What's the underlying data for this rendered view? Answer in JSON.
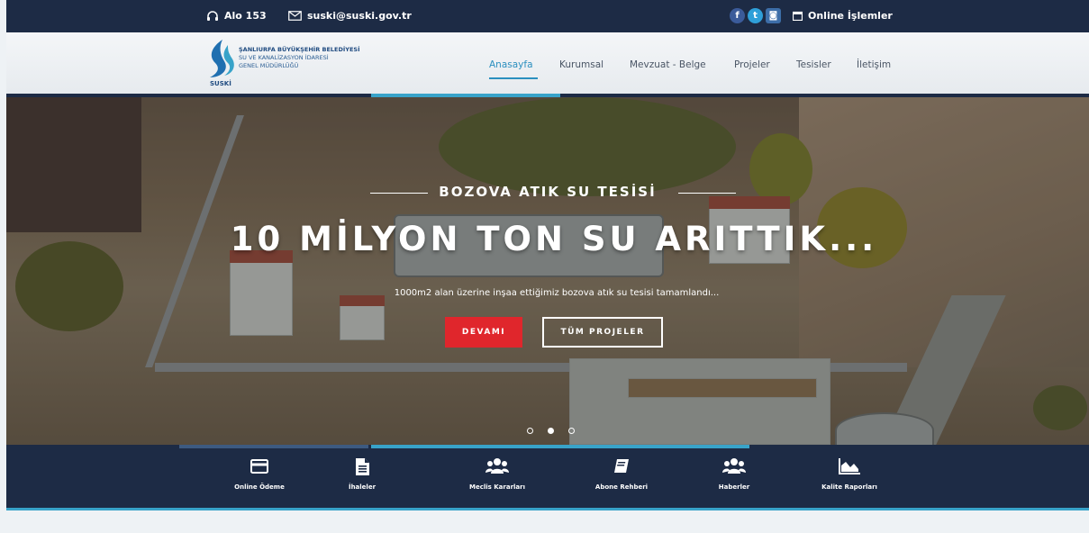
{
  "topbar": {
    "phone_label": "Alo 153",
    "email_label": "suski@suski.gov.tr",
    "social": [
      {
        "icon": "facebook-icon",
        "glyph": "f",
        "color": "#3b5b9a"
      },
      {
        "icon": "twitter-icon",
        "glyph": "t",
        "color": "#2f9fd8"
      },
      {
        "icon": "instagram-icon",
        "glyph": "◙",
        "color": "#3d6ea8"
      }
    ],
    "online_label": "Online İşlemler"
  },
  "logo": {
    "line1": "ŞANLIURFA BÜYÜKŞEHİR BELEDİYESİ",
    "line2": "SU VE KANALİZASYON İDARESİ",
    "line3": "GENEL MÜDÜRLÜĞÜ",
    "brand": "SUSKİ"
  },
  "nav": {
    "items": [
      {
        "label": "Anasayfa",
        "active": true
      },
      {
        "label": "Kurumsal"
      },
      {
        "label": "Mevzuat - Belge"
      },
      {
        "label": "Projeler"
      },
      {
        "label": "Tesisler"
      },
      {
        "label": "İletişim"
      }
    ]
  },
  "hero": {
    "subtitle": "BOZOVA ATIK SU TESİSİ",
    "title": "10 MİLYON TON SU ARITTIK...",
    "description": "1000m2 alan üzerine inşaa ettiğimiz bozova atık su tesisi tamamlandı...",
    "primary_button": "DEVAMI",
    "secondary_button": "TÜM PROJELER",
    "slides_total": 3,
    "active_slide": 2
  },
  "quick_links": [
    {
      "label": "Online Ödeme",
      "icon": "credit-card-icon"
    },
    {
      "label": "İhaleler",
      "icon": "document-icon"
    },
    {
      "label": "Meclis Kararları",
      "icon": "users-icon"
    },
    {
      "label": "Abone Rehberi",
      "icon": "book-icon"
    },
    {
      "label": "Haberler",
      "icon": "users-group-icon"
    },
    {
      "label": "Kalite Raporları",
      "icon": "area-chart-icon"
    }
  ],
  "colors": {
    "navy": "#1d2b45",
    "accent": "#38a3c9",
    "red": "#e0262c",
    "active_nav": "#2b8fbf"
  }
}
